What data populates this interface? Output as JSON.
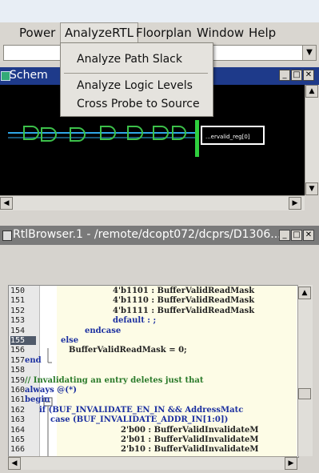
{
  "menu": {
    "items": [
      {
        "label": "Power"
      },
      {
        "label": "AnalyzeRTL"
      },
      {
        "label": "Floorplan"
      },
      {
        "label": "Window"
      },
      {
        "label": "Help"
      }
    ],
    "active_index": 1
  },
  "dropdown": {
    "items": [
      {
        "label": "Analyze Path Slack"
      },
      {
        "label": "Analyze Logic Levels"
      },
      {
        "label": "Cross Probe to Source"
      }
    ]
  },
  "combo": {
    "value": ""
  },
  "schematic": {
    "title": "Schem",
    "selected_cell_label": "...ervalid_reg[0]"
  },
  "rtl_browser": {
    "title": "RtlBrowser.1 - /remote/dcopt072/dcprs/D1306...",
    "current_line": "155",
    "lines": [
      {
        "num": "150",
        "text": "4'b1101   : BufferValidReadMask"
      },
      {
        "num": "151",
        "text": "4'b1110   : BufferValidReadMask"
      },
      {
        "num": "152",
        "text": "4'b1111   : BufferValidReadMask"
      },
      {
        "num": "153",
        "text": "default   : ;"
      },
      {
        "num": "154",
        "text": "endcase"
      },
      {
        "num": "155",
        "text": "else"
      },
      {
        "num": "156",
        "text": "BufferValidReadMask = 0;"
      },
      {
        "num": "157",
        "text": "end"
      },
      {
        "num": "158",
        "text": ""
      },
      {
        "num": "159",
        "text": "// Invalidating an entry deletes just that"
      },
      {
        "num": "160",
        "text": "always @(*)"
      },
      {
        "num": "161",
        "text": "begin"
      },
      {
        "num": "162",
        "text": "if (BUF_INVALIDATE_EN_IN && AddressMatc"
      },
      {
        "num": "163",
        "text": "case (BUF_INVALIDATE_ADDR_IN[1:0])"
      },
      {
        "num": "164",
        "text": "2'b00   : BufferValidInvalidateM"
      },
      {
        "num": "165",
        "text": "2'b01   : BufferValidInvalidateM"
      },
      {
        "num": "166",
        "text": "2'b10   : BufferValidInvalidateM"
      }
    ]
  }
}
